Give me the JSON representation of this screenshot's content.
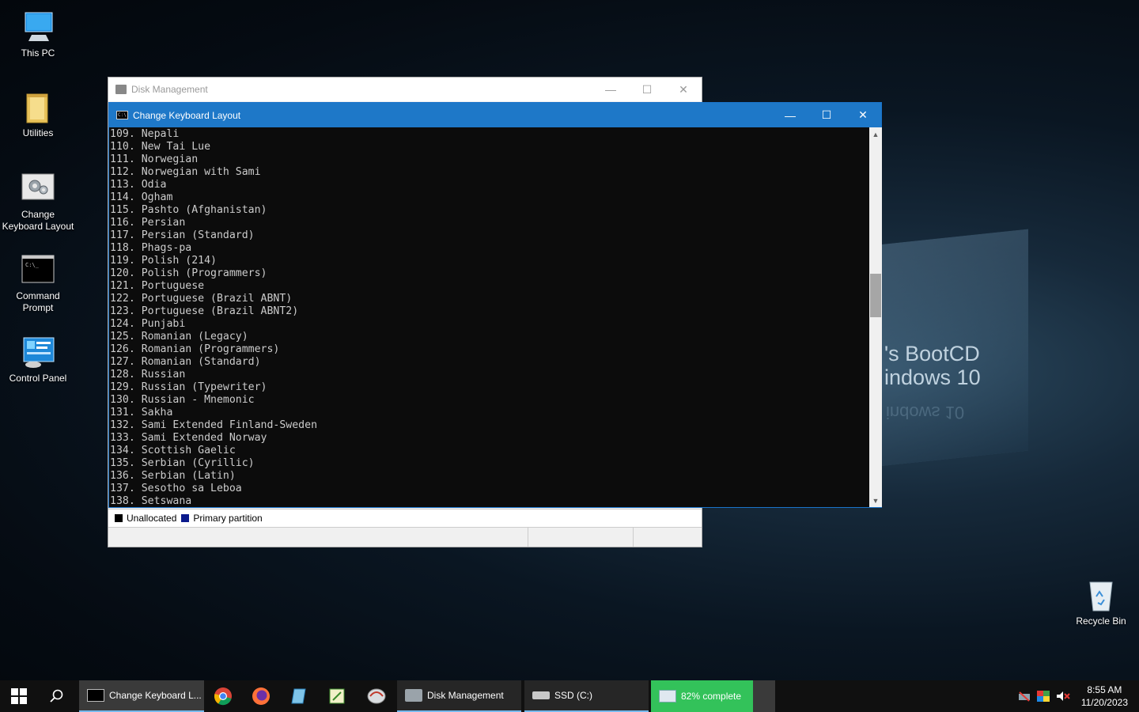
{
  "wallpaper": {
    "line1": "'s BootCD",
    "line2": "indows 10",
    "mirror": "indows 10"
  },
  "desktop_icons": [
    {
      "label": "This PC"
    },
    {
      "label": "Utilities"
    },
    {
      "label": "Change Keyboard Layout"
    },
    {
      "label": "Command Prompt"
    },
    {
      "label": "Control Panel"
    },
    {
      "label": "Recycle Bin"
    }
  ],
  "disk_management": {
    "title": "Disk Management",
    "legend": [
      {
        "label": "Unallocated",
        "color": "#000000"
      },
      {
        "label": "Primary partition",
        "color": "#0b1a8c"
      }
    ]
  },
  "console": {
    "title": "Change Keyboard Layout",
    "lines": [
      "109. Nepali",
      "110. New Tai Lue",
      "111. Norwegian",
      "112. Norwegian with Sami",
      "113. Odia",
      "114. Ogham",
      "115. Pashto (Afghanistan)",
      "116. Persian",
      "117. Persian (Standard)",
      "118. Phags-pa",
      "119. Polish (214)",
      "120. Polish (Programmers)",
      "121. Portuguese",
      "122. Portuguese (Brazil ABNT)",
      "123. Portuguese (Brazil ABNT2)",
      "124. Punjabi",
      "125. Romanian (Legacy)",
      "126. Romanian (Programmers)",
      "127. Romanian (Standard)",
      "128. Russian",
      "129. Russian (Typewriter)",
      "130. Russian - Mnemonic",
      "131. Sakha",
      "132. Sami Extended Finland-Sweden",
      "133. Sami Extended Norway",
      "134. Scottish Gaelic",
      "135. Serbian (Cyrillic)",
      "136. Serbian (Latin)",
      "137. Sesotho sa Leboa",
      "138. Setswana"
    ]
  },
  "window_controls": {
    "minimize": "—",
    "maximize": "☐",
    "close": "✕"
  },
  "taskbar": {
    "apps": [
      {
        "label": "Change Keyboard L..."
      },
      {
        "label": "Disk Management"
      },
      {
        "label": "SSD (C:)"
      },
      {
        "label": "82% complete",
        "progress": 0.82
      }
    ],
    "clock": {
      "time": "8:55 AM",
      "date": "11/20/2023"
    }
  },
  "colors": {
    "accent": "#1e78c8",
    "progress_green": "#33c25a"
  }
}
